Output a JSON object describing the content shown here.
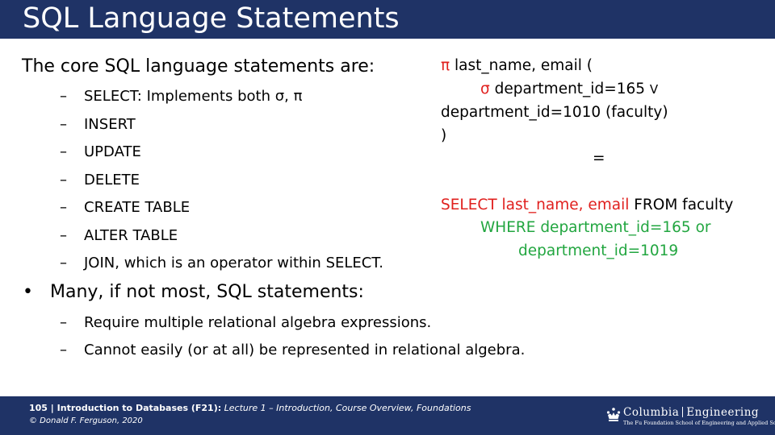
{
  "slide": {
    "title": "SQL Language Statements",
    "intro": "The core SQL language statements are:",
    "sub_items": [
      "SELECT: Implements both σ, π",
      "INSERT",
      "UPDATE",
      "DELETE",
      "CREATE TABLE",
      "ALTER TABLE",
      "JOIN, which is an operator within SELECT."
    ],
    "bullet": "Many, if not most, SQL statements:",
    "bullet_sub_items": [
      "Require multiple relational algebra expressions.",
      "Cannot easily (or at all) be represented in relational algebra."
    ],
    "dash_symbol": "–",
    "bullet_symbol": "•"
  },
  "relational_algebra": {
    "pi_symbol": "π",
    "line1_rest": " last_name, email (",
    "sigma_symbol": "σ",
    "line2_rest": " department_id=165 ",
    "or_symbol": "V",
    "line3": "department_id=1010 (faculty)",
    "line4": ")",
    "equals": "="
  },
  "sql": {
    "select_kw": "SELECT last_name, email",
    "from_kw": " FROM faculty",
    "where_line1": "WHERE department_id=165 or",
    "where_line2": "department_id=1019"
  },
  "footer": {
    "page_number": "105",
    "separator": " | ",
    "course": "Introduction to Databases (F21):",
    "lecture": " Lecture 1 – Introduction, Course Overview, Foundations",
    "copyright": "© Donald F. Ferguson, 2020"
  },
  "logo": {
    "left_word": "Columbia",
    "right_word": "Engineering",
    "subtitle": "The Fu Foundation School of Engineering and Applied Science"
  },
  "colors": {
    "bar": "#1f3366",
    "red": "#e0201e",
    "green": "#22a640"
  }
}
